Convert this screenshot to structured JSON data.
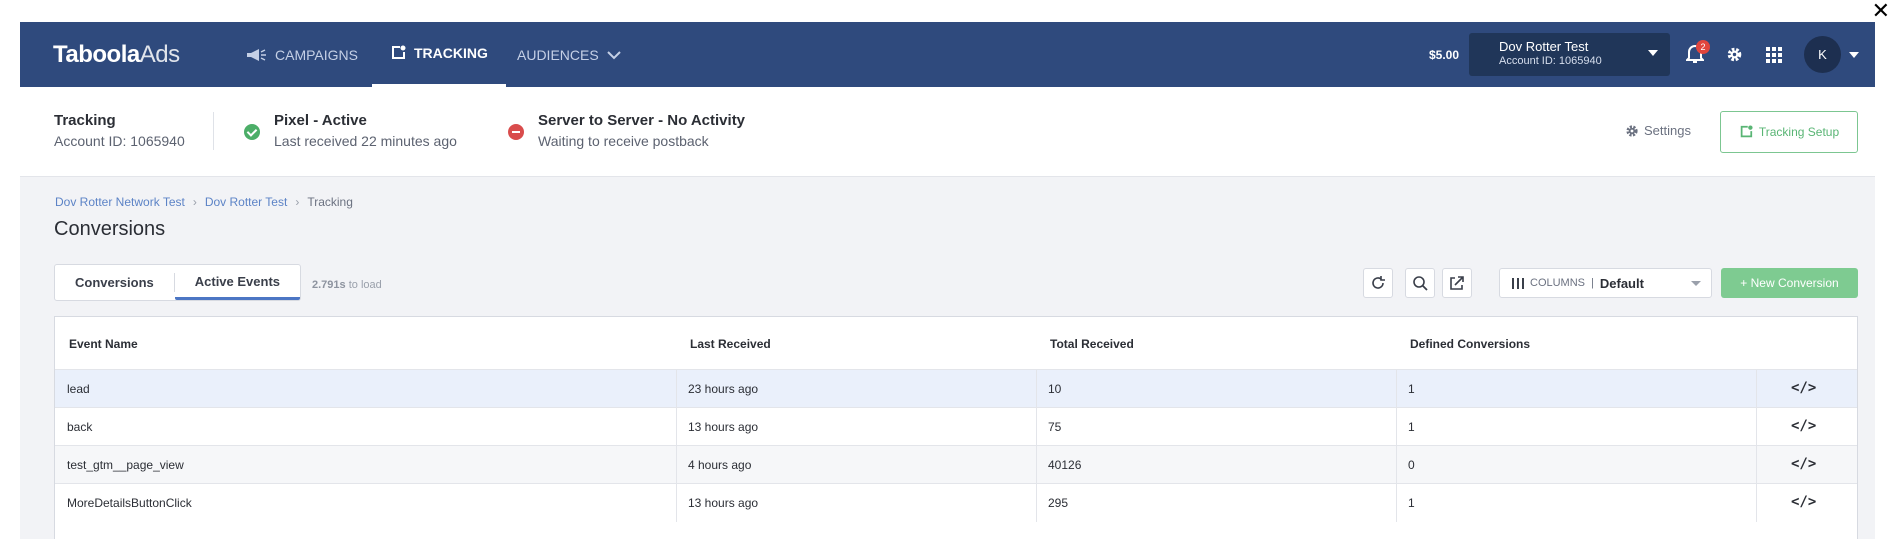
{
  "window": {
    "close_glyph": "✕"
  },
  "brand": {
    "logo_bold": "Taboola",
    "logo_light": "Ads"
  },
  "nav": {
    "items": [
      {
        "label": "CAMPAIGNS",
        "icon": "megaphone-icon",
        "active": false
      },
      {
        "label": "TRACKING",
        "icon": "tracking-icon",
        "active": true
      },
      {
        "label": "AUDIENCES",
        "icon": "chevron-down-icon",
        "active": false
      }
    ],
    "balance": "$5.00",
    "account": {
      "name": "Dov Rotter Test",
      "id_text": "Account ID: 1065940"
    },
    "notifications_count": "2",
    "avatar_initial": "K"
  },
  "status": {
    "title": "Tracking",
    "account_id": "Account ID: 1065940",
    "pixel": {
      "title": "Pixel - Active",
      "subtitle": "Last received 22 minutes ago",
      "state_color": "#4cae68"
    },
    "s2s": {
      "title": "Server to Server - No Activity",
      "subtitle": "Waiting to receive postback",
      "state_color": "#d94c4c"
    },
    "settings_label": "Settings",
    "setup_label": "Tracking Setup"
  },
  "breadcrumb": {
    "items": [
      "Dov Rotter Network Test",
      "Dov Rotter Test",
      "Tracking"
    ]
  },
  "page_title": "Conversions",
  "tabs": {
    "conversions": "Conversions",
    "active_events": "Active Events"
  },
  "load_time": {
    "value": "2.791s",
    "suffix": " to load"
  },
  "toolbar": {
    "columns_label": "COLUMNS",
    "columns_divider": "|",
    "columns_value": "Default",
    "new_conversion": "+ New Conversion"
  },
  "table": {
    "headers": [
      "Event Name",
      "Last Received",
      "Total Received",
      "Defined Conversions"
    ],
    "rows": [
      [
        "lead",
        "23 hours ago",
        "10",
        "1"
      ],
      [
        "back",
        "13 hours ago",
        "75",
        "1"
      ],
      [
        "test_gtm__page_view",
        "4 hours ago",
        "40126",
        "0"
      ],
      [
        "MoreDetailsButtonClick",
        "13 hours ago",
        "295",
        "1"
      ]
    ],
    "code_icon": "</>"
  },
  "colors": {
    "nav_bg": "#2f4a7d",
    "accent_green": "#7ecb91",
    "link_blue": "#5c83c6"
  }
}
